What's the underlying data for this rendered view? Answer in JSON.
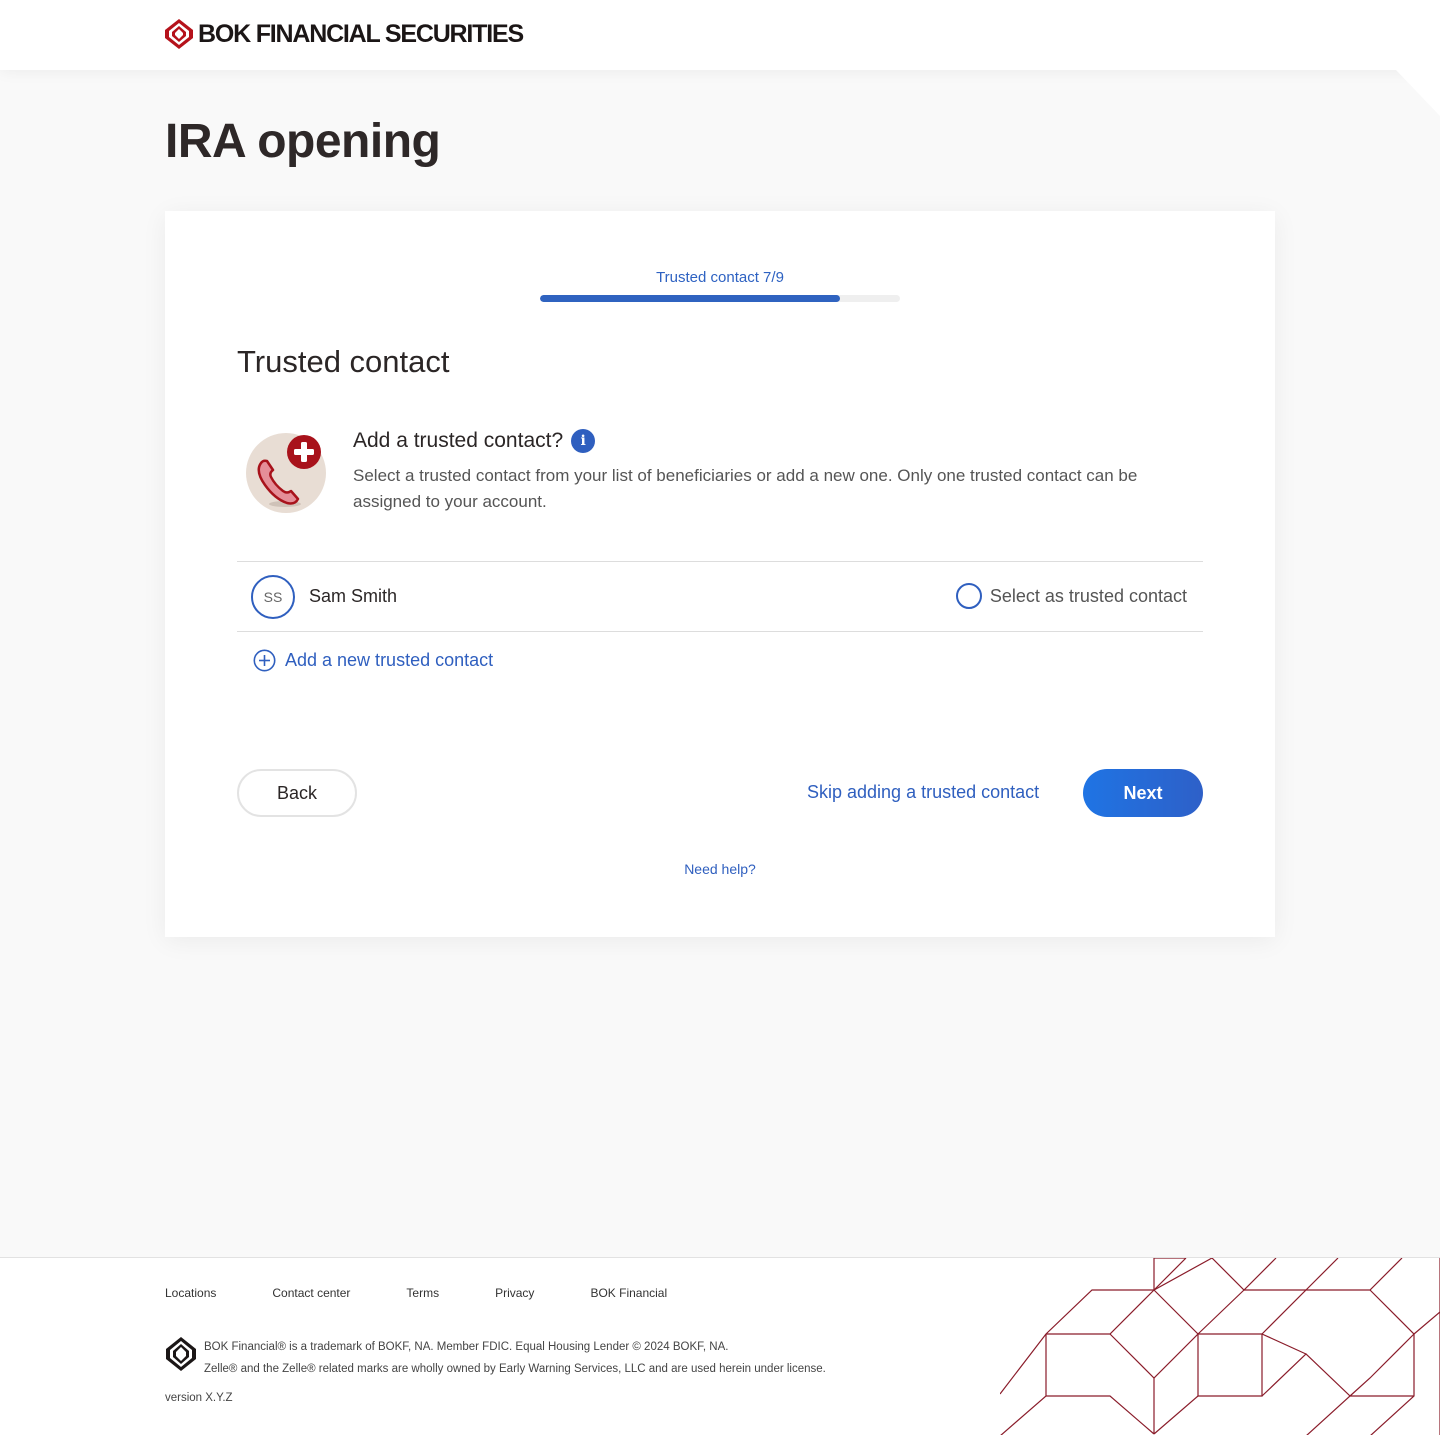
{
  "header": {
    "brand": "BOK FINANCIAL SECURITIES"
  },
  "page": {
    "title": "IRA opening"
  },
  "progress": {
    "label": "Trusted contact 7/9",
    "step": 7,
    "total": 9,
    "fraction": 0.833
  },
  "section": {
    "title": "Trusted contact",
    "question": "Add a trusted contact?",
    "description": "Select a trusted contact from your list of beneficiaries or add a new one. Only one trusted contact can be assigned to your account.",
    "illustration_icon": "phone-add-icon",
    "info_icon": "info-icon"
  },
  "contacts": [
    {
      "initials": "SS",
      "name": "Sam Smith",
      "select_label": "Select as trusted contact",
      "selected": false
    }
  ],
  "add_contact": {
    "label": "Add a new trusted contact",
    "icon": "plus-circle-icon"
  },
  "actions": {
    "back_label": "Back",
    "skip_label": "Skip adding a trusted contact",
    "next_label": "Next",
    "help_label": "Need help?"
  },
  "footer": {
    "nav": [
      "Locations",
      "Contact center",
      "Terms",
      "Privacy",
      "BOK Financial"
    ],
    "legal_line1": "BOK Financial® is a trademark of BOKF, NA. Member FDIC. Equal Housing Lender  © 2024 BOKF, NA.",
    "legal_line2": "Zelle® and the Zelle® related marks are wholly owned by Early Warning Services, LLC and are used herein under license.",
    "version": "version X.Y.Z"
  },
  "colors": {
    "brand_red": "#b5121b",
    "accent_blue": "#2f5fbf",
    "next_gradient_start": "#1f74e4",
    "pattern": "#8a1c2a"
  }
}
